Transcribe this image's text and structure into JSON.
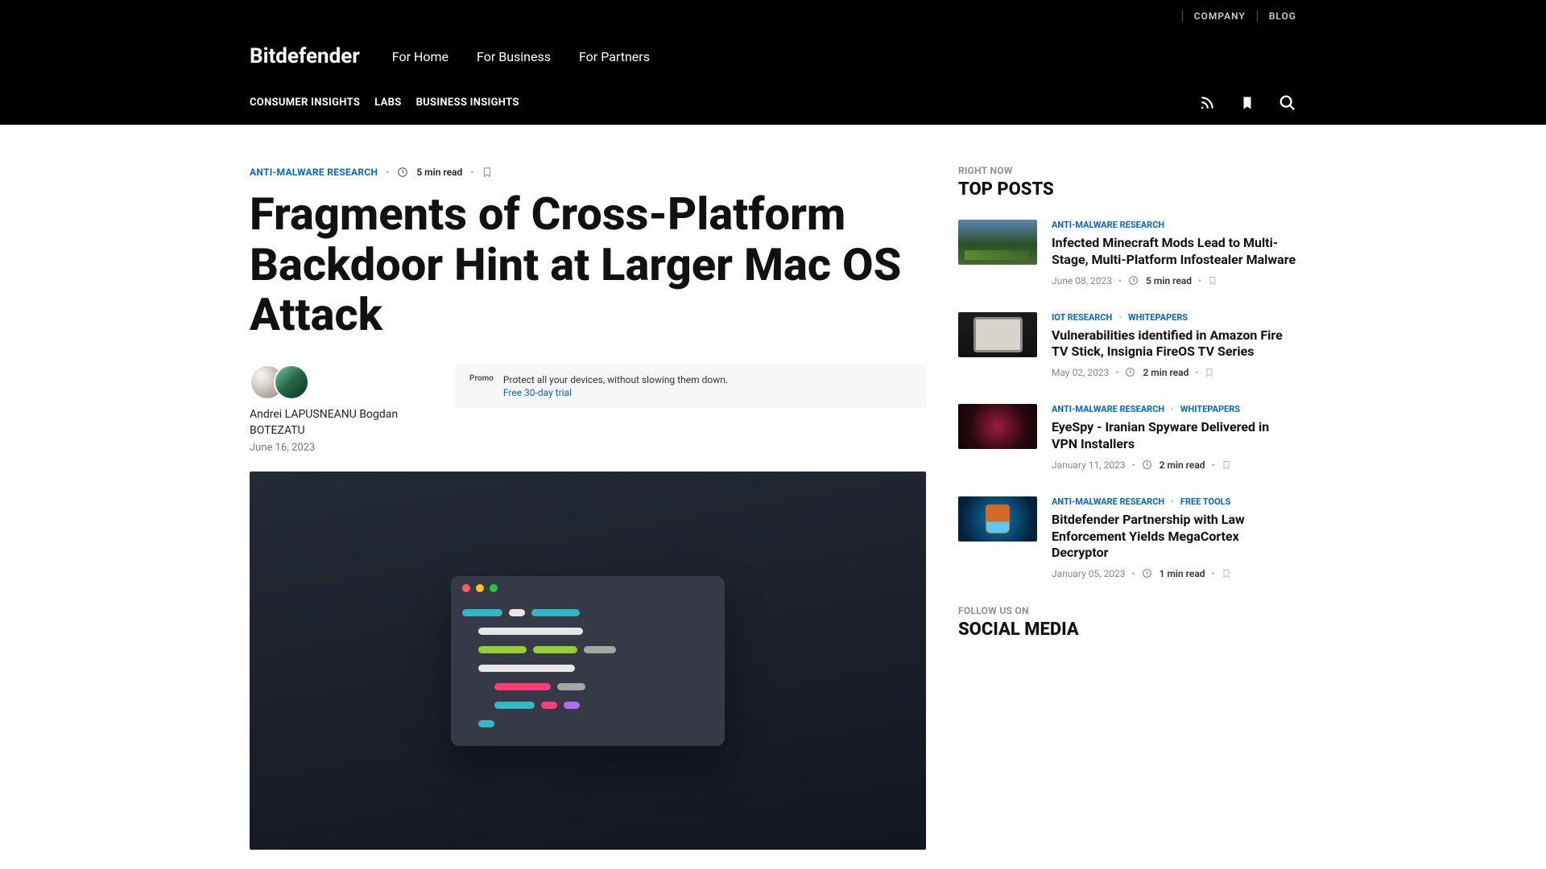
{
  "topbar": {
    "company": "COMPANY",
    "blog": "BLOG"
  },
  "logo_text": "Bitdefender",
  "nav": {
    "home": "For Home",
    "business": "For Business",
    "partners": "For Partners"
  },
  "categories": {
    "consumer": "CONSUMER INSIGHTS",
    "labs": "LABS",
    "business": "BUSINESS INSIGHTS"
  },
  "colors": {
    "link": "#0066d6"
  },
  "article": {
    "category": "ANTI-MALWARE RESEARCH",
    "read_time": "5 min read",
    "title": "Fragments of Cross-Platform Backdoor Hint at Larger Mac OS Attack",
    "authors": [
      "Andrei LAPUSNEANU",
      "Bogdan BOTEZATU"
    ],
    "authors_joined": "Andrei LAPUSNEANU   Bogdan BOTEZATU",
    "date": "June 16, 2023"
  },
  "promo": {
    "tag": "Promo",
    "text": "Protect all your devices, without slowing them down.",
    "link_label": "Free 30-day trial"
  },
  "sidebar": {
    "right_now": "RIGHT NOW",
    "top_posts_heading": "TOP POSTS",
    "follow_us": "FOLLOW US ON",
    "social_heading": "SOCIAL MEDIA"
  },
  "posts": [
    {
      "cats": [
        "ANTI-MALWARE RESEARCH"
      ],
      "title": "Infected Minecraft Mods Lead to Multi-Stage, Multi-Platform Infostealer Malware",
      "date": "June 08, 2023",
      "read": "5 min read"
    },
    {
      "cats": [
        "IOT RESEARCH",
        "WHITEPAPERS"
      ],
      "title": "Vulnerabilities identified in Amazon Fire TV Stick, Insignia FireOS TV Series",
      "date": "May 02, 2023",
      "read": "2 min read"
    },
    {
      "cats": [
        "ANTI-MALWARE RESEARCH",
        "WHITEPAPERS"
      ],
      "title": "EyeSpy - Iranian Spyware Delivered in VPN Installers",
      "date": "January 11, 2023",
      "read": "2 min read"
    },
    {
      "cats": [
        "ANTI-MALWARE RESEARCH",
        "FREE TOOLS"
      ],
      "title": "Bitdefender Partnership with Law Enforcement Yields MegaCortex Decryptor",
      "date": "January 05, 2023",
      "read": "1 min read"
    }
  ]
}
